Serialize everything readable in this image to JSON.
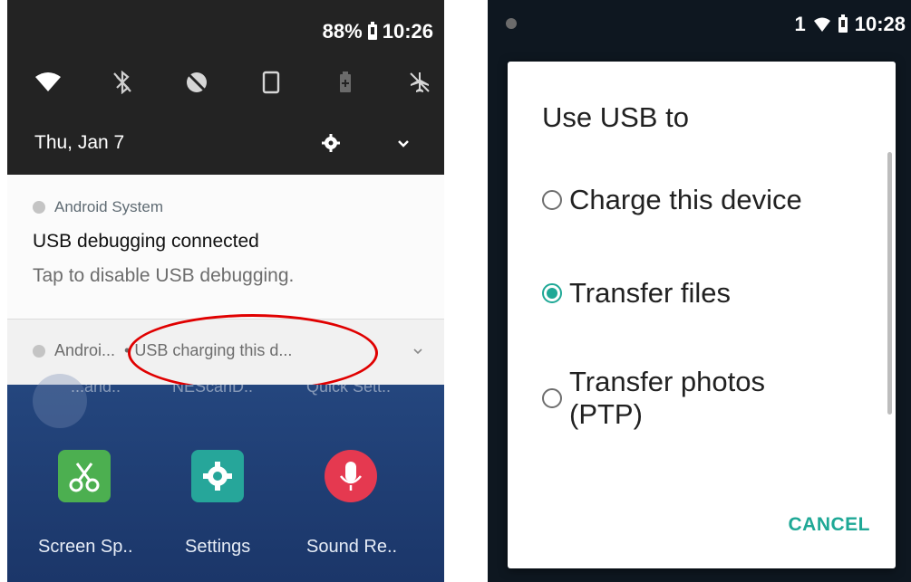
{
  "left_panel": {
    "status": {
      "battery": "88%",
      "time": "10:26"
    },
    "quick_settings": [
      "wifi-icon",
      "bluetooth-off-icon",
      "do-not-disturb-icon",
      "auto-rotate-icon",
      "battery-saver-icon",
      "airplane-mode-icon"
    ],
    "date": "Thu, Jan 7",
    "notification_1": {
      "app": "Android System",
      "title": "USB debugging connected",
      "text": "Tap to disable USB debugging."
    },
    "notification_2": {
      "app": "Androi...",
      "text": "• USB charging this d..."
    },
    "home_screen": {
      "hidden_labels": [
        "...and..",
        "NEScanD..",
        "Quick Sett.."
      ],
      "apps": [
        {
          "label": "Screen Sp..",
          "icon": "scissors-icon",
          "color": "#4caf50"
        },
        {
          "label": "Settings",
          "icon": "gear-icon",
          "color": "#26a69a"
        },
        {
          "label": "Sound Re..",
          "icon": "microphone-icon",
          "color": "#e53950"
        }
      ]
    },
    "highlight_color": "#e00000"
  },
  "right_panel": {
    "status": {
      "sim": "1",
      "time": "10:28"
    },
    "dialog": {
      "title": "Use USB to",
      "options": [
        {
          "label": "Charge this device",
          "selected": false
        },
        {
          "label": "Transfer files",
          "selected": true
        },
        {
          "label_line1": "Transfer photos",
          "label_line2": "(PTP)",
          "selected": false
        }
      ],
      "cancel_label": "CANCEL",
      "accent_color": "#1fa896"
    }
  }
}
